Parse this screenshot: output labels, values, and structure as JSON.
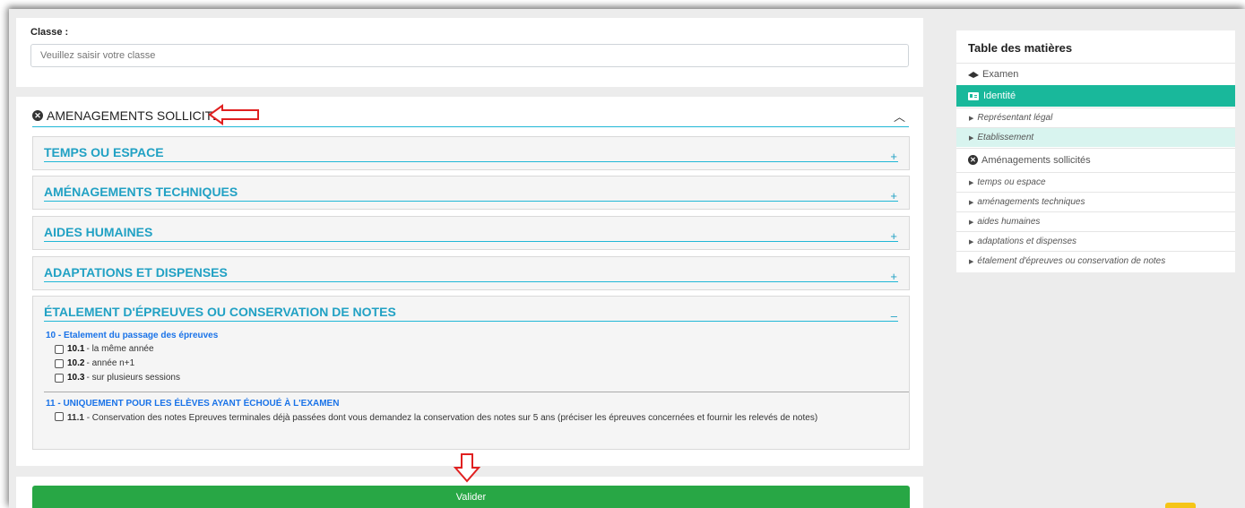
{
  "classe": {
    "label": "Classe :",
    "placeholder": "Veuillez saisir votre classe"
  },
  "amenagements": {
    "title": "AMENAGEMENTS SOLLICITES",
    "sections": [
      {
        "title": "TEMPS OU ESPACE",
        "toggle": "+"
      },
      {
        "title": "AMÉNAGEMENTS TECHNIQUES",
        "toggle": "+"
      },
      {
        "title": "AIDES HUMAINES",
        "toggle": "+"
      },
      {
        "title": "ADAPTATIONS ET DISPENSES",
        "toggle": "+"
      },
      {
        "title": "ÉTALEMENT D'ÉPREUVES OU CONSERVATION DE NOTES",
        "toggle": "–"
      }
    ],
    "etalement": {
      "group10_title": "10 - Etalement du passage des épreuves",
      "items10": [
        {
          "code": "10.1",
          "text": " - la même année"
        },
        {
          "code": "10.2",
          "text": " - année n+1"
        },
        {
          "code": "10.3",
          "text": " - sur plusieurs sessions"
        }
      ],
      "group11_title": "11 - UNIQUEMENT POUR LES ÉLÈVES AYANT ÉCHOUÉ À L'EXAMEN",
      "item11": {
        "code": "11.1",
        "text": " - Conservation des notes Epreuves terminales déjà passées dont vous demandez la conservation des notes sur 5 ans (préciser les épreuves concernées et fournir les relevés de notes)"
      }
    }
  },
  "valider_label": "Valider",
  "toc": {
    "title": "Table des matières",
    "items": [
      {
        "label": "Examen"
      },
      {
        "label": "Identité"
      },
      {
        "label": "Représentant légal"
      },
      {
        "label": "Etablissement"
      },
      {
        "label": "Aménagements sollicités"
      },
      {
        "label": "temps ou espace"
      },
      {
        "label": "aménagements techniques"
      },
      {
        "label": "aides humaines"
      },
      {
        "label": "adaptations et dispenses"
      },
      {
        "label": "étalement d'épreuves ou conservation de notes"
      }
    ]
  },
  "colors": {
    "accent": "#21a1c4",
    "toc_active": "#19b89b",
    "button": "#28a745",
    "annotation": "#e02020"
  }
}
